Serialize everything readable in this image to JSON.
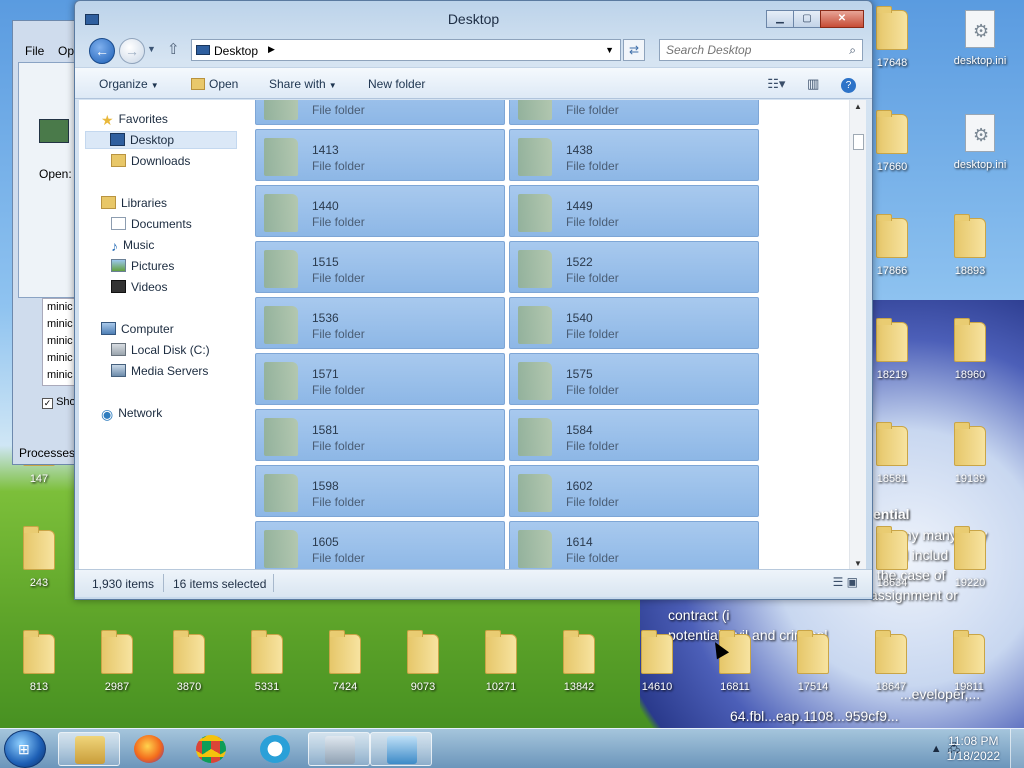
{
  "explorer": {
    "title": "Desktop",
    "address": "Desktop",
    "search_placeholder": "Search Desktop",
    "toolbar": {
      "organize": "Organize",
      "open": "Open",
      "share_with": "Share with",
      "new_folder": "New folder"
    },
    "nav": {
      "favorites": "Favorites",
      "desktop": "Desktop",
      "downloads": "Downloads",
      "libraries": "Libraries",
      "documents": "Documents",
      "music": "Music",
      "pictures": "Pictures",
      "videos": "Videos",
      "computer": "Computer",
      "local_disk": "Local Disk (C:)",
      "media_servers": "Media Servers",
      "network": "Network"
    },
    "items": [
      {
        "name": "1413",
        "type": "File folder"
      },
      {
        "name": "1438",
        "type": "File folder"
      },
      {
        "name": "1440",
        "type": "File folder"
      },
      {
        "name": "1449",
        "type": "File folder"
      },
      {
        "name": "1515",
        "type": "File folder"
      },
      {
        "name": "1522",
        "type": "File folder"
      },
      {
        "name": "1536",
        "type": "File folder"
      },
      {
        "name": "1540",
        "type": "File folder"
      },
      {
        "name": "1571",
        "type": "File folder"
      },
      {
        "name": "1575",
        "type": "File folder"
      },
      {
        "name": "1581",
        "type": "File folder"
      },
      {
        "name": "1584",
        "type": "File folder"
      },
      {
        "name": "1598",
        "type": "File folder"
      },
      {
        "name": "1602",
        "type": "File folder"
      },
      {
        "name": "1605",
        "type": "File folder"
      },
      {
        "name": "1614",
        "type": "File folder"
      }
    ],
    "partial_type": "File folder",
    "status": {
      "count": "1,930 items",
      "selected": "16 items selected"
    }
  },
  "background_window": {
    "menu_file": "File",
    "menu_options": "Op",
    "open_label": "Open:",
    "list_items": [
      "minic",
      "minic",
      "minic",
      "minic",
      "minic"
    ],
    "show_label": "Sho",
    "processes_label": "Processes"
  },
  "desktop": {
    "icons": [
      {
        "label": "17648",
        "kind": "folder"
      },
      {
        "label": "desktop.ini",
        "kind": "ini"
      },
      {
        "label": "17660",
        "kind": "folder"
      },
      {
        "label": "desktop.ini",
        "kind": "ini"
      },
      {
        "label": "17866",
        "kind": "folder"
      },
      {
        "label": "18893",
        "kind": "folder"
      },
      {
        "label": "18219",
        "kind": "folder"
      },
      {
        "label": "18960",
        "kind": "folder"
      },
      {
        "label": "18581",
        "kind": "folder"
      },
      {
        "label": "19139",
        "kind": "folder"
      },
      {
        "label": "18634",
        "kind": "folder"
      },
      {
        "label": "19220",
        "kind": "folder"
      },
      {
        "label": "147",
        "kind": "folder"
      },
      {
        "label": "243",
        "kind": "folder"
      },
      {
        "label": "813",
        "kind": "folder"
      },
      {
        "label": "2987",
        "kind": "folder"
      },
      {
        "label": "3870",
        "kind": "folder"
      },
      {
        "label": "5331",
        "kind": "folder"
      },
      {
        "label": "7424",
        "kind": "folder"
      },
      {
        "label": "9073",
        "kind": "folder"
      },
      {
        "label": "10271",
        "kind": "folder"
      },
      {
        "label": "13842",
        "kind": "folder"
      },
      {
        "label": "14610",
        "kind": "folder"
      },
      {
        "label": "16811",
        "kind": "folder"
      },
      {
        "label": "17514",
        "kind": "folder"
      },
      {
        "label": "18647",
        "kind": "folder"
      },
      {
        "label": "19811",
        "kind": "folder"
      }
    ],
    "wallpaper_text": [
      "ential",
      "my many may",
      "d includ",
      "the case of",
      "assignment or",
      "contract (i",
      "potential civil and criminal",
      "...eveloper,...",
      "64.fbl...eap.1108...959cf9..."
    ]
  },
  "taskbar": {
    "time": "11:08 PM",
    "date": "1/18/2022"
  }
}
